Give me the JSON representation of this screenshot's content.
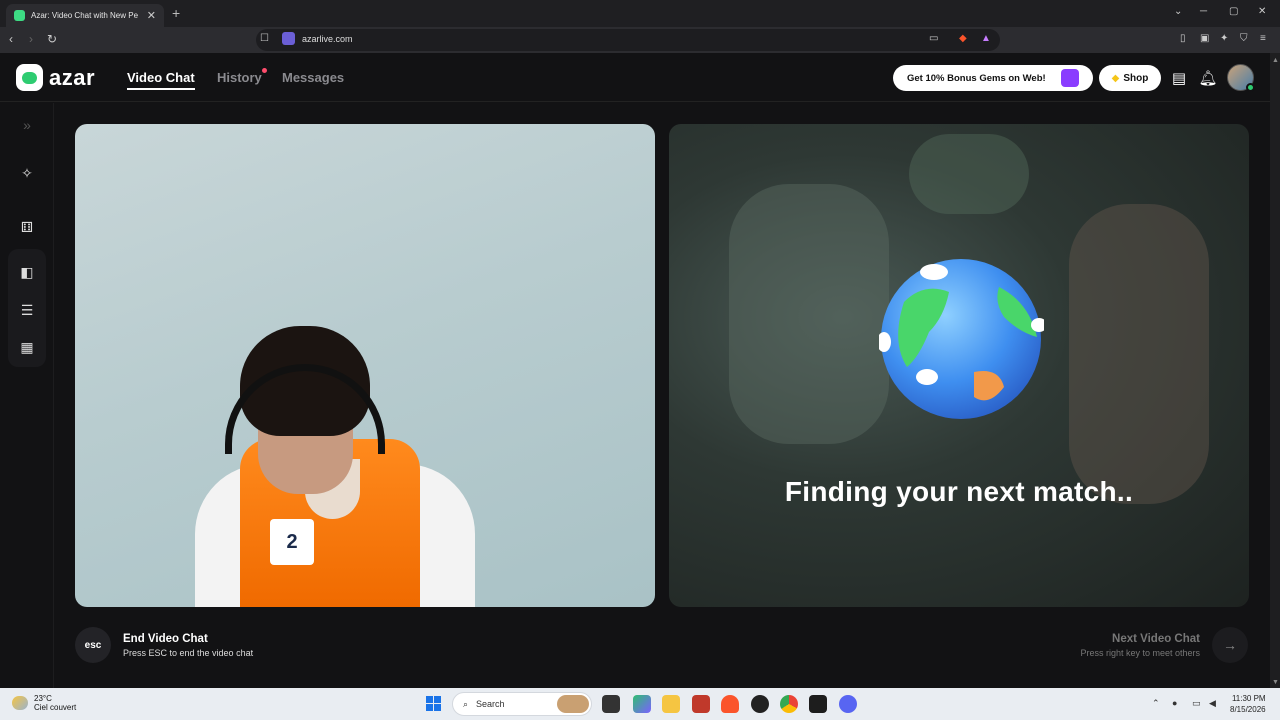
{
  "browser": {
    "tab_title": "Azar: Video Chat with New Pe",
    "url": "azarlive.com",
    "new_tab": "+"
  },
  "nav": {
    "logo": "azar",
    "links": [
      "Video Chat",
      "History",
      "Messages"
    ],
    "active": "Video Chat",
    "history_has_notification": true,
    "promo": "Get 10% Bonus Gems on Web!",
    "shop": "Shop"
  },
  "sidebar": {
    "icons": [
      "expand-icon",
      "magic-wand-icon",
      "dice-icon",
      "layout-side-by-side-icon",
      "layout-stacked-icon",
      "layout-grid-icon"
    ],
    "active_layout": "side-by-side"
  },
  "remote": {
    "status": "Finding your next match.."
  },
  "controls": {
    "esc_key": "esc",
    "end_title": "End Video Chat",
    "end_hint": "Press ESC to end the video chat",
    "next_title": "Next Video Chat",
    "next_hint": "Press right key to meet others"
  },
  "taskbar": {
    "temperature": "23°C",
    "weather": "Ciel couvert",
    "search": "Search",
    "time": "11:30 PM",
    "date": "8/15/2026"
  },
  "colors": {
    "accent": "#2ecc71",
    "background": "#121214",
    "notification": "#ff4d6d"
  }
}
